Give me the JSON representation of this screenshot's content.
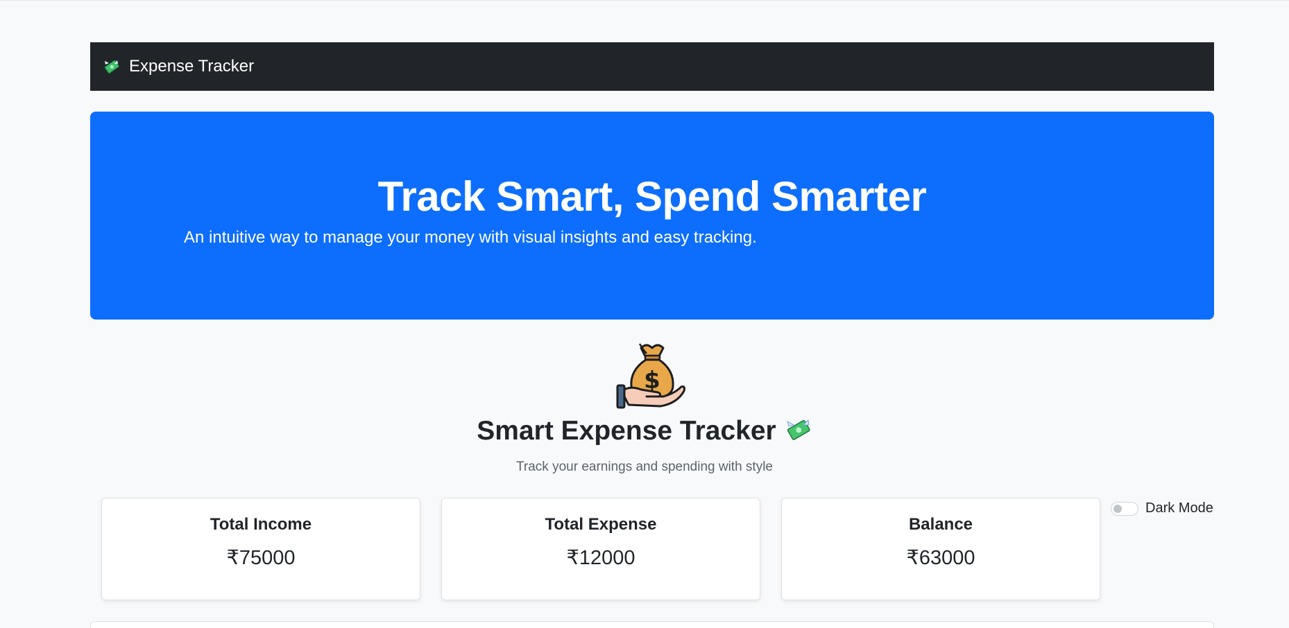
{
  "navbar": {
    "brand_icon": "money-with-wings-icon",
    "brand_text": "Expense Tracker"
  },
  "hero": {
    "title": "Track Smart, Spend Smarter",
    "subtitle": "An intuitive way to manage your money with visual insights and easy tracking."
  },
  "app": {
    "illustration": "money-bag-hand-icon",
    "title": "Smart Expense Tracker",
    "title_icon": "money-with-wings-icon",
    "subtitle": "Track your earnings and spending with style"
  },
  "summary": {
    "cards": [
      {
        "label": "Total Income",
        "value": "₹75000"
      },
      {
        "label": "Total Expense",
        "value": "₹12000"
      },
      {
        "label": "Balance",
        "value": "₹63000"
      }
    ]
  },
  "dark_mode": {
    "label": "Dark Mode",
    "enabled": false
  },
  "colors": {
    "navbar_bg": "#212529",
    "hero_bg": "#0d6efd",
    "page_bg": "#f8f9fa"
  }
}
